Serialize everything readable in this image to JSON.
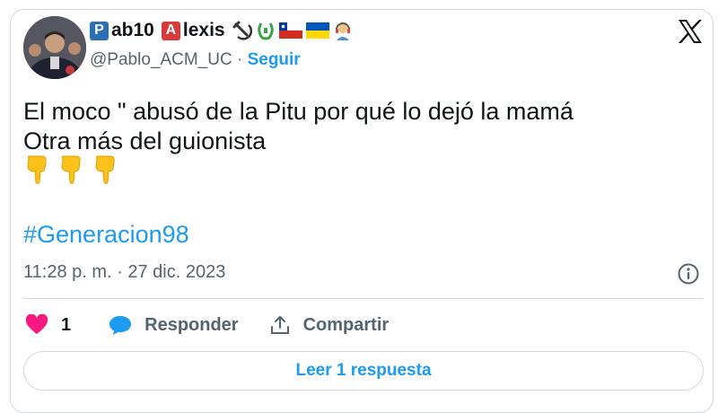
{
  "author": {
    "name_box1": "P",
    "name_part1": "ab10",
    "name_box2": "A",
    "name_part2": "lexis",
    "handle": "@Pablo_ACM_UC",
    "separator": "·",
    "follow_label": "Seguir",
    "emoji_icons": [
      "hammer-sickle-icon",
      "wreath-icon",
      "chile-flag-icon",
      "ukraine-flag-icon",
      "person-headphones-icon"
    ]
  },
  "tweet": {
    "line1": "El moco \" abusó de la Pitu por qué lo dejó la mamá",
    "line2": "Otra más del guionista",
    "emojis": [
      "pointing-down-hand-icon",
      "pointing-down-hand-icon",
      "pointing-down-hand-icon"
    ],
    "hashtag": "#Generacion98",
    "timestamp": "11:28 p. m. · 27 dic. 2023"
  },
  "actions": {
    "like_count": "1",
    "reply_label": "Responder",
    "share_label": "Compartir"
  },
  "read_button": "Leer 1 respuesta",
  "colors": {
    "accent": "#1d9bf0",
    "like": "#f91880",
    "secondary_text": "#536471",
    "border": "#cfd9de"
  }
}
